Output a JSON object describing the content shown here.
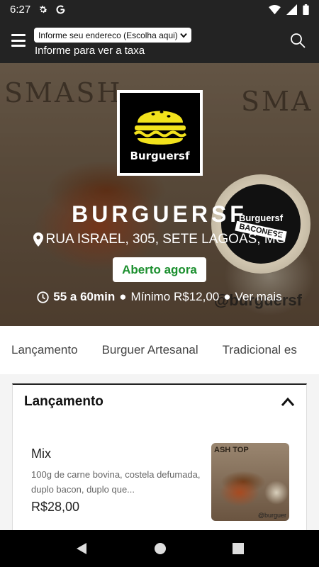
{
  "status_bar": {
    "time": "6:27"
  },
  "header": {
    "address_select": "Informe seu endereco (Escolha aqui)",
    "address_hint": "Informe para ver a taxa"
  },
  "store": {
    "name": "BURGUERSF",
    "address": "RUA ISRAEL, 305, SETE LAGOAS, MG",
    "status": "Aberto agora",
    "delivery_time": "55 a 60min",
    "minimum": "Mínimo R$12,00",
    "see_more": "Ver mais",
    "logo_text": "Burguersf",
    "sauce_label": "Burguersf",
    "sauce_tag": "BACONESE",
    "watermark": "@burguersf"
  },
  "categories": [
    "Lançamento",
    "Burguer Artesanal",
    "Tradicional es"
  ],
  "section": {
    "title": "Lançamento",
    "products": [
      {
        "name": "Mix",
        "description": "100g de carne bovina, costela defumada, duplo bacon, duplo que...",
        "price": "R$28,00",
        "image_caption": "ASH TOP",
        "image_handle": "@burguer"
      }
    ]
  },
  "colors": {
    "header": "#232323",
    "open": "#1b8f2e"
  }
}
